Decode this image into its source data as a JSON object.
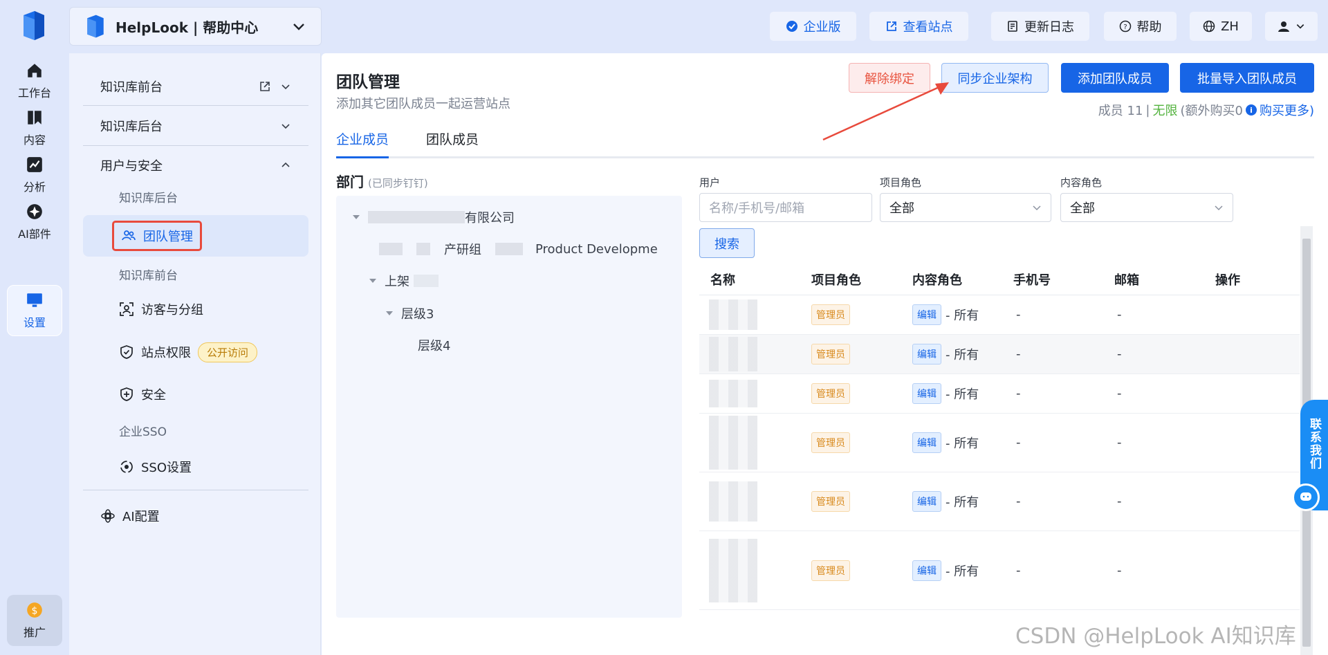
{
  "rail": {
    "items": [
      {
        "label": "工作台",
        "icon": "home-icon"
      },
      {
        "label": "内容",
        "icon": "book-icon"
      },
      {
        "label": "分析",
        "icon": "chart-icon"
      },
      {
        "label": "AI部件",
        "icon": "ai-widget-icon"
      },
      {
        "label": "设置",
        "icon": "monitor-icon",
        "active": true
      }
    ],
    "promo": {
      "label": "推广",
      "icon": "coin-icon"
    }
  },
  "header": {
    "project_name": "HelpLook | 帮助中心",
    "enterprise": "企业版",
    "view_site": "查看站点",
    "changelog": "更新日志",
    "help": "帮助",
    "lang": "ZH"
  },
  "sidebar": {
    "groups": {
      "frontend": "知识库前台",
      "backend": "知识库后台",
      "user_security": "用户与安全",
      "ai_config": "AI配置"
    },
    "sub": {
      "backend": "知识库后台",
      "team": "团队管理",
      "frontend": "知识库前台",
      "visitors": "访客与分组",
      "site_perm": "站点权限",
      "site_perm_badge": "公开访问",
      "security": "安全",
      "sso_group": "企业SSO",
      "sso_settings": "SSO设置"
    }
  },
  "main": {
    "title": "团队管理",
    "subtitle": "添加其它团队成员一起运营站点",
    "actions": {
      "unbind": "解除绑定",
      "sync": "同步企业架构",
      "add": "添加团队成员",
      "bulk": "批量导入团队成员"
    },
    "members": {
      "count": "成员 11",
      "sep": "|",
      "unlimited": "无限",
      "extra": "(额外购买0",
      "buy_more": "购买更多)"
    },
    "tabs": [
      "企业成员",
      "团队成员"
    ],
    "dept": {
      "title": "部门",
      "note": "(已同步钉钉)",
      "company": "有限公司",
      "rd": "产研组",
      "rd_en": "Product Developme",
      "shangjia": "上架",
      "level3": "层级3",
      "level4": "层级4"
    },
    "filters": {
      "user_label": "用户",
      "user_placeholder": "名称/手机号/邮箱",
      "project_role_label": "项目角色",
      "project_role_value": "全部",
      "content_role_label": "内容角色",
      "content_role_value": "全部",
      "search": "搜索"
    },
    "table": {
      "headers": [
        "名称",
        "项目角色",
        "内容角色",
        "手机号",
        "邮箱",
        "操作"
      ],
      "rows": [
        {
          "role": "管理员",
          "content_role": "编辑",
          "scope": "- 所有",
          "phone": "-",
          "email": "-"
        },
        {
          "role": "管理员",
          "content_role": "编辑",
          "scope": "- 所有",
          "phone": "-",
          "email": "-"
        },
        {
          "role": "管理员",
          "content_role": "编辑",
          "scope": "- 所有",
          "phone": "-",
          "email": "-"
        },
        {
          "role": "管理员",
          "content_role": "编辑",
          "scope": "- 所有",
          "phone": "-",
          "email": "-"
        },
        {
          "role": "管理员",
          "content_role": "编辑",
          "scope": "- 所有",
          "phone": "-",
          "email": "-"
        },
        {
          "role": "管理员",
          "content_role": "编辑",
          "scope": "- 所有",
          "phone": "-",
          "email": "-"
        }
      ]
    }
  },
  "contact": "联系我们",
  "watermark": "CSDN @HelpLook AI知识库",
  "colors": {
    "primary": "#1765e6",
    "danger": "#e8533f",
    "highlight_box": "#e84a3c",
    "arrow": "#e84a3c"
  }
}
